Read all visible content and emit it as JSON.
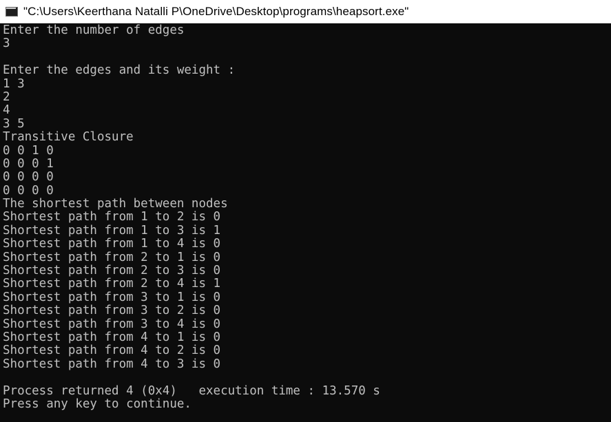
{
  "window": {
    "title": "\"C:\\Users\\Keerthana Natalli P\\OneDrive\\Desktop\\programs\\heapsort.exe\"",
    "icon": "console-app-icon"
  },
  "console": {
    "lines": [
      "Enter the number of edges",
      "3",
      "",
      "Enter the edges and its weight :",
      "1 3",
      "2",
      "4",
      "3 5",
      "Transitive Closure",
      "0 0 1 0",
      "0 0 0 1",
      "0 0 0 0",
      "0 0 0 0",
      "The shortest path between nodes",
      "Shortest path from 1 to 2 is 0",
      "Shortest path from 1 to 3 is 1",
      "Shortest path from 1 to 4 is 0",
      "Shortest path from 2 to 1 is 0",
      "Shortest path from 2 to 3 is 0",
      "Shortest path from 2 to 4 is 1",
      "Shortest path from 3 to 1 is 0",
      "Shortest path from 3 to 2 is 0",
      "Shortest path from 3 to 4 is 0",
      "Shortest path from 4 to 1 is 0",
      "Shortest path from 4 to 2 is 0",
      "Shortest path from 4 to 3 is 0",
      "",
      "Process returned 4 (0x4)   execution time : 13.570 s",
      "Press any key to continue."
    ]
  }
}
